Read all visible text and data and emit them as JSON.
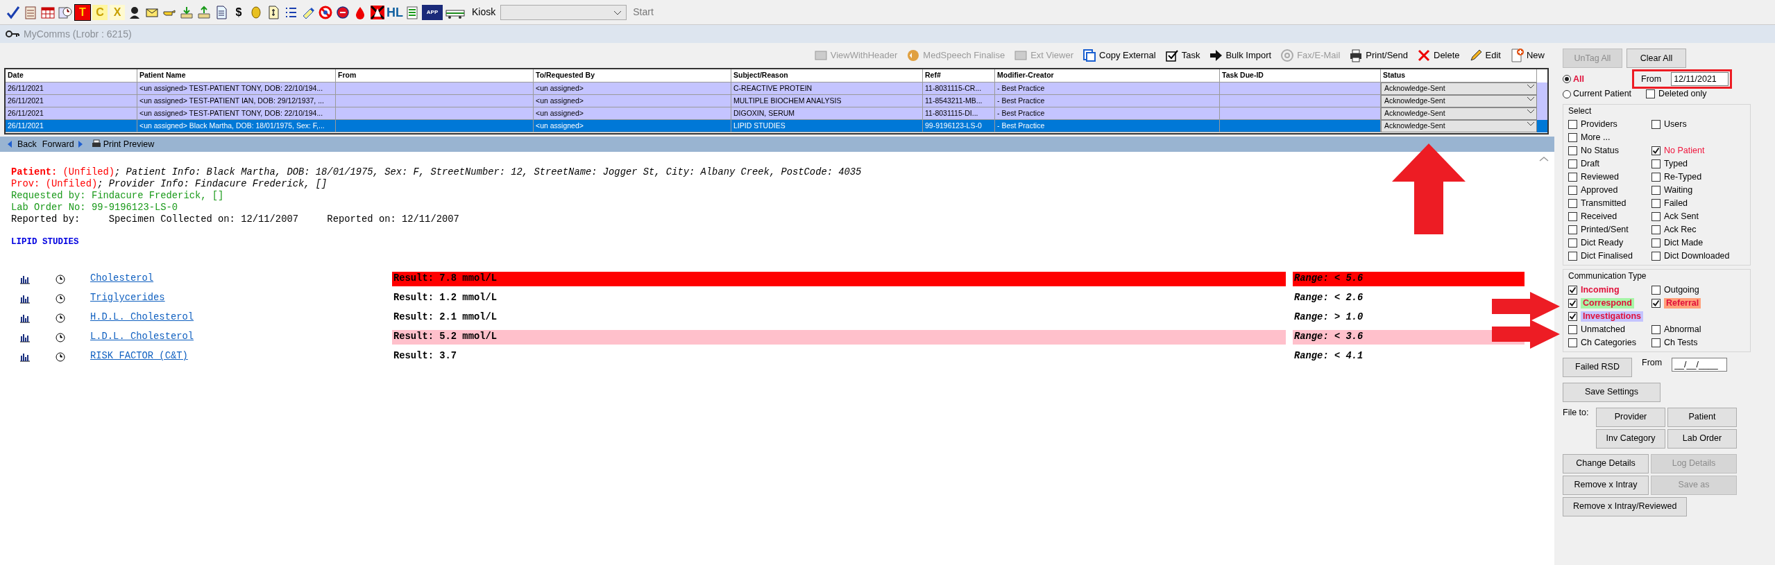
{
  "toolbar": {
    "letters": [
      "T",
      "C",
      "X",
      "$",
      "HL",
      "APP"
    ],
    "kiosk_label": "Kiosk",
    "start_label": "Start"
  },
  "window": {
    "title": "MyComms (Lrobr : 6215)"
  },
  "actions": [
    {
      "label": "ViewWithHeader",
      "disabled": true
    },
    {
      "label": "MedSpeech Finalise",
      "disabled": true
    },
    {
      "label": "Ext Viewer",
      "disabled": true
    },
    {
      "label": "Copy External",
      "disabled": false
    },
    {
      "label": "Task",
      "disabled": false
    },
    {
      "label": "Bulk Import",
      "disabled": false
    },
    {
      "label": "Fax/E-Mail",
      "disabled": true
    },
    {
      "label": "Print/Send",
      "disabled": false
    },
    {
      "label": "Delete",
      "disabled": false
    },
    {
      "label": "Edit",
      "disabled": false
    },
    {
      "label": "New",
      "disabled": false
    }
  ],
  "table": {
    "columns": [
      "Date",
      "Patient Name",
      "From",
      "To/Requested By",
      "Subject/Reason",
      "Ref#",
      "Modifier-Creator",
      "Task Due-ID",
      "Status"
    ],
    "rows": [
      {
        "cells": [
          "26/11/2021",
          "<un assigned> TEST-PATIENT TONY, DOB: 22/10/194...",
          "",
          "<un assigned>",
          "C-REACTIVE PROTEIN",
          "11-8031115-CR...",
          "- Best Practice",
          ""
        ],
        "status": "Acknowledge-Sent",
        "selected": false
      },
      {
        "cells": [
          "26/11/2021",
          "<un assigned> TEST-PATIENT IAN, DOB: 29/12/1937, ...",
          "",
          "<un assigned>",
          "MULTIPLE BIOCHEM ANALYSIS",
          "11-8543211-MB...",
          "- Best Practice",
          ""
        ],
        "status": "Acknowledge-Sent",
        "selected": false
      },
      {
        "cells": [
          "26/11/2021",
          "<un assigned> TEST-PATIENT TONY, DOB: 22/10/194...",
          "",
          "<un assigned>",
          "DIGOXIN, SERUM",
          "11-8031115-DI...",
          "- Best Practice",
          ""
        ],
        "status": "Acknowledge-Sent",
        "selected": false
      },
      {
        "cells": [
          "26/11/2021",
          "<un assigned> Black Martha, DOB: 18/01/1975, Sex: F,...",
          "",
          "<un assigned>",
          "LIPID STUDIES",
          "99-9196123-LS-0",
          "- Best Practice",
          ""
        ],
        "status": "Acknowledge-Sent",
        "selected": true
      }
    ]
  },
  "nav": [
    "Back",
    "Forward",
    "Print Preview"
  ],
  "report": {
    "lines": [
      [
        {
          "text": "Patient: ",
          "color": "#ff0000",
          "bold": true
        },
        {
          "text": "(Unfiled)",
          "color": "#ff0000"
        },
        {
          "text": "; Patient Info: Black Martha, DOB: 18/01/1975, Sex: F, StreetNumber: 12, StreetName: Jogger St, City: Albany Creek, PostCode: 4035",
          "color": "#000000",
          "italic": true
        }
      ],
      [
        {
          "text": "Prov: (Unfiled)",
          "color": "#ff0000"
        },
        {
          "text": "; Provider Info: Findacure Frederick, []",
          "color": "#000000",
          "italic": true
        }
      ],
      [
        {
          "text": "Requested by: Findacure Frederick, []",
          "color": "#1a9a1a"
        }
      ],
      [
        {
          "text": "Lab Order No: 99-9196123-LS-0",
          "color": "#1a9a1a"
        }
      ],
      [
        {
          "text": "Reported by:     Specimen Collected on: 12/11/2007     Reported on: 12/11/2007",
          "color": "#000000"
        }
      ]
    ],
    "heading": "LIPID STUDIES",
    "results": [
      {
        "test": "Cholesterol",
        "result": "Result: 7.8 mmol/L",
        "range": "Range: < 5.6",
        "color": "#ff0000"
      },
      {
        "test": "Triglycerides",
        "result": "Result: 1.2 mmol/L",
        "range": "Range: < 2.6"
      },
      {
        "test": "H.D.L. Cholesterol",
        "result": "Result: 2.1 mmol/L",
        "range": "Range: > 1.0"
      },
      {
        "test": "L.D.L. Cholesterol",
        "result": "Result: 5.2 mmol/L",
        "range": "Range: < 3.6",
        "color": "#ffc0cb"
      },
      {
        "test": "RISK FACTOR (C&T)",
        "result": "Result: 3.7",
        "range": "Range: < 4.1"
      }
    ]
  },
  "filters": {
    "top_buttons": [
      {
        "label": "UnTag All",
        "disabled": true
      },
      {
        "label": "Clear All",
        "disabled": false
      }
    ],
    "scope": [
      {
        "label": "All",
        "selected": true
      },
      {
        "label": "Current Patient",
        "selected": false
      }
    ],
    "from_label": "From",
    "from_value": "12/11/2021",
    "deleted_only": {
      "label": "Deleted only",
      "checked": false
    },
    "select": {
      "title": "Select",
      "rows": [
        [
          {
            "label": "Providers",
            "checked": false
          },
          {
            "label": "Users",
            "checked": false
          }
        ],
        [
          {
            "label": "More ...",
            "checked": false
          }
        ],
        [
          {
            "label": "No Status",
            "checked": false
          },
          {
            "label": "No Patient",
            "checked": true
          }
        ],
        [
          {
            "label": "Draft",
            "checked": false
          },
          {
            "label": "Typed",
            "checked": false
          }
        ],
        [
          {
            "label": "Reviewed",
            "checked": false
          },
          {
            "label": "Re-Typed",
            "checked": false
          }
        ],
        [
          {
            "label": "Approved",
            "checked": false
          },
          {
            "label": "Waiting",
            "checked": false
          }
        ],
        [
          {
            "label": "Transmitted",
            "checked": false
          },
          {
            "label": "Failed",
            "checked": false
          }
        ],
        [
          {
            "label": "Received",
            "checked": false
          },
          {
            "label": "Ack Sent",
            "checked": false
          }
        ],
        [
          {
            "label": "Printed/Sent",
            "checked": false
          },
          {
            "label": "Ack Rec",
            "checked": false
          }
        ],
        [
          {
            "label": "Dict Ready",
            "checked": false
          },
          {
            "label": "Dict Made",
            "checked": false
          }
        ],
        [
          {
            "label": "Dict Finalised",
            "checked": false
          },
          {
            "label": "Dict Downloaded",
            "checked": false
          }
        ]
      ]
    },
    "comm_type": {
      "title": "Communication Type",
      "rows": [
        [
          {
            "label": "Incoming",
            "checked": true
          },
          {
            "label": "Outgoing",
            "checked": false
          }
        ],
        [
          {
            "label": "Correspond",
            "checked": true,
            "color": "#a6f5a6"
          },
          {
            "label": "Referral",
            "checked": true,
            "color": "#ffa07a"
          }
        ],
        [
          {
            "label": "Investigations",
            "checked": true,
            "color": "#c4c4ff"
          }
        ],
        [
          {
            "label": "Unmatched",
            "checked": false
          },
          {
            "label": "Abnormal",
            "checked": false
          }
        ],
        [
          {
            "label": "Ch Categories",
            "checked": false
          },
          {
            "label": "Ch Tests",
            "checked": false
          }
        ]
      ]
    },
    "failed_rsd": "Failed RSD",
    "rsd_from_label": "From",
    "rsd_from_value": "__/__/____",
    "save_settings": "Save Settings",
    "file_to": {
      "label": "File to:",
      "buttons": [
        "Provider",
        "Patient",
        "Inv Category",
        "Lab Order"
      ]
    },
    "bottom_buttons": [
      {
        "label": "Change Details",
        "disabled": false
      },
      {
        "label": "Log Details",
        "disabled": true
      },
      {
        "label": "Remove x Intray",
        "disabled": false
      },
      {
        "label": "Save as",
        "disabled": true
      },
      {
        "label": "Remove x Intray/Reviewed",
        "disabled": false
      }
    ]
  }
}
